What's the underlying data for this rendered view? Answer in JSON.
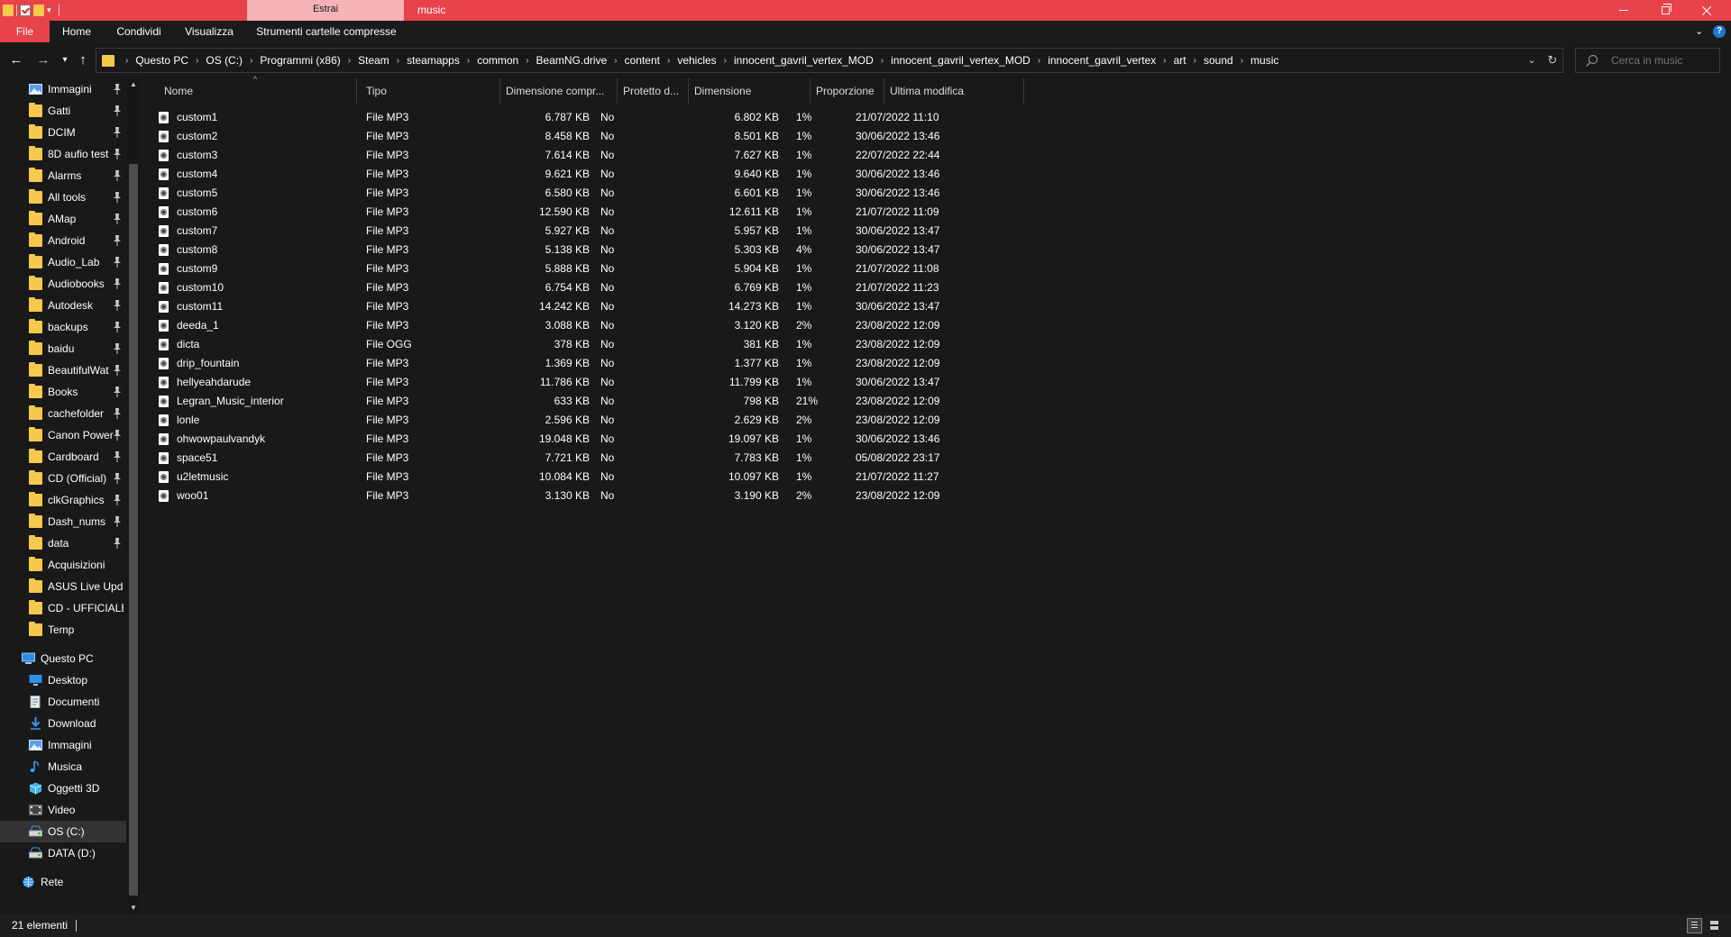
{
  "window": {
    "title": "music",
    "contextual_tab_group": "Estrai",
    "buttons": {
      "minimize": "minimize",
      "maximize": "restore",
      "close": "close"
    }
  },
  "ribbon": {
    "tabs": [
      {
        "label": "File",
        "active": true
      },
      {
        "label": "Home"
      },
      {
        "label": "Condividi"
      },
      {
        "label": "Visualizza"
      },
      {
        "label": "Strumenti cartelle compresse"
      }
    ],
    "help": "?"
  },
  "address": {
    "crumbs": [
      "Questo PC",
      "OS (C:)",
      "Programmi (x86)",
      "Steam",
      "steamapps",
      "common",
      "BeamNG.drive",
      "content",
      "vehicles",
      "innocent_gavril_vertex_MOD",
      "innocent_gavril_vertex_MOD",
      "innocent_gavril_vertex",
      "art",
      "sound",
      "music"
    ]
  },
  "search": {
    "placeholder": "Cerca in music"
  },
  "colors": {
    "accent": "#e8424a",
    "contextual": "#f5b3b7",
    "folder": "#f6c94c",
    "background": "#191919"
  },
  "nav": {
    "quick_access": [
      {
        "label": "Immagini",
        "icon": "pictures-icon",
        "pinned": true
      },
      {
        "label": "Gatti",
        "icon": "folder-icon",
        "pinned": true
      },
      {
        "label": "DCIM",
        "icon": "folder-icon",
        "pinned": true
      },
      {
        "label": "8D aufio test",
        "icon": "folder-icon",
        "pinned": true
      },
      {
        "label": "Alarms",
        "icon": "folder-icon",
        "pinned": true
      },
      {
        "label": "All tools",
        "icon": "folder-icon",
        "pinned": true
      },
      {
        "label": "AMap",
        "icon": "folder-icon",
        "pinned": true
      },
      {
        "label": "Android",
        "icon": "folder-icon",
        "pinned": true
      },
      {
        "label": "Audio_Lab",
        "icon": "folder-icon",
        "pinned": true
      },
      {
        "label": "Audiobooks",
        "icon": "folder-icon",
        "pinned": true
      },
      {
        "label": "Autodesk",
        "icon": "folder-icon",
        "pinned": true
      },
      {
        "label": "backups",
        "icon": "folder-icon",
        "pinned": true
      },
      {
        "label": "baidu",
        "icon": "folder-icon",
        "pinned": true
      },
      {
        "label": "BeautifulWat",
        "icon": "folder-icon",
        "pinned": true
      },
      {
        "label": "Books",
        "icon": "folder-icon",
        "pinned": true
      },
      {
        "label": "cachefolder",
        "icon": "folder-icon",
        "pinned": true
      },
      {
        "label": "Canon Power",
        "icon": "folder-icon",
        "pinned": true
      },
      {
        "label": "Cardboard",
        "icon": "folder-icon",
        "pinned": true
      },
      {
        "label": "CD (Official)",
        "icon": "folder-icon",
        "pinned": true
      },
      {
        "label": "clkGraphics",
        "icon": "folder-icon",
        "pinned": true
      },
      {
        "label": "Dash_nums",
        "icon": "folder-icon",
        "pinned": true
      },
      {
        "label": "data",
        "icon": "folder-icon",
        "pinned": true
      },
      {
        "label": "Acquisizioni",
        "icon": "folder-icon",
        "pinned": false
      },
      {
        "label": "ASUS Live Updat",
        "icon": "folder-icon",
        "pinned": false
      },
      {
        "label": "CD - UFFICIALE",
        "icon": "folder-icon",
        "pinned": false
      },
      {
        "label": "Temp",
        "icon": "folder-icon",
        "pinned": false
      }
    ],
    "this_pc": {
      "label": "Questo PC",
      "children": [
        {
          "label": "Desktop",
          "icon": "desktop-icon"
        },
        {
          "label": "Documenti",
          "icon": "documents-icon"
        },
        {
          "label": "Download",
          "icon": "download-icon"
        },
        {
          "label": "Immagini",
          "icon": "pictures-icon"
        },
        {
          "label": "Musica",
          "icon": "music-icon"
        },
        {
          "label": "Oggetti 3D",
          "icon": "cube-icon"
        },
        {
          "label": "Video",
          "icon": "video-icon"
        },
        {
          "label": "OS (C:)",
          "icon": "drive-icon",
          "selected": true
        },
        {
          "label": "DATA (D:)",
          "icon": "drive-icon"
        }
      ]
    },
    "network": {
      "label": "Rete",
      "icon": "network-icon"
    }
  },
  "columns": [
    "Nome",
    "Tipo",
    "Dimensione compr...",
    "Protetto d...",
    "Dimensione",
    "Proporzione",
    "Ultima modifica"
  ],
  "files": [
    {
      "name": "custom1",
      "type": "File MP3",
      "compressed": "6.787 KB",
      "protected": "No",
      "size": "6.802 KB",
      "ratio": "1%",
      "modified": "21/07/2022 11:10"
    },
    {
      "name": "custom2",
      "type": "File MP3",
      "compressed": "8.458 KB",
      "protected": "No",
      "size": "8.501 KB",
      "ratio": "1%",
      "modified": "30/06/2022 13:46"
    },
    {
      "name": "custom3",
      "type": "File MP3",
      "compressed": "7.614 KB",
      "protected": "No",
      "size": "7.627 KB",
      "ratio": "1%",
      "modified": "22/07/2022 22:44"
    },
    {
      "name": "custom4",
      "type": "File MP3",
      "compressed": "9.621 KB",
      "protected": "No",
      "size": "9.640 KB",
      "ratio": "1%",
      "modified": "30/06/2022 13:46"
    },
    {
      "name": "custom5",
      "type": "File MP3",
      "compressed": "6.580 KB",
      "protected": "No",
      "size": "6.601 KB",
      "ratio": "1%",
      "modified": "30/06/2022 13:46"
    },
    {
      "name": "custom6",
      "type": "File MP3",
      "compressed": "12.590 KB",
      "protected": "No",
      "size": "12.611 KB",
      "ratio": "1%",
      "modified": "21/07/2022 11:09"
    },
    {
      "name": "custom7",
      "type": "File MP3",
      "compressed": "5.927 KB",
      "protected": "No",
      "size": "5.957 KB",
      "ratio": "1%",
      "modified": "30/06/2022 13:47"
    },
    {
      "name": "custom8",
      "type": "File MP3",
      "compressed": "5.138 KB",
      "protected": "No",
      "size": "5.303 KB",
      "ratio": "4%",
      "modified": "30/06/2022 13:47"
    },
    {
      "name": "custom9",
      "type": "File MP3",
      "compressed": "5.888 KB",
      "protected": "No",
      "size": "5.904 KB",
      "ratio": "1%",
      "modified": "21/07/2022 11:08"
    },
    {
      "name": "custom10",
      "type": "File MP3",
      "compressed": "6.754 KB",
      "protected": "No",
      "size": "6.769 KB",
      "ratio": "1%",
      "modified": "21/07/2022 11:23"
    },
    {
      "name": "custom11",
      "type": "File MP3",
      "compressed": "14.242 KB",
      "protected": "No",
      "size": "14.273 KB",
      "ratio": "1%",
      "modified": "30/06/2022 13:47"
    },
    {
      "name": "deeda_1",
      "type": "File MP3",
      "compressed": "3.088 KB",
      "protected": "No",
      "size": "3.120 KB",
      "ratio": "2%",
      "modified": "23/08/2022 12:09"
    },
    {
      "name": "dicta",
      "type": "File OGG",
      "compressed": "378 KB",
      "protected": "No",
      "size": "381 KB",
      "ratio": "1%",
      "modified": "23/08/2022 12:09"
    },
    {
      "name": "drip_fountain",
      "type": "File MP3",
      "compressed": "1.369 KB",
      "protected": "No",
      "size": "1.377 KB",
      "ratio": "1%",
      "modified": "23/08/2022 12:09"
    },
    {
      "name": "hellyeahdarude",
      "type": "File MP3",
      "compressed": "11.786 KB",
      "protected": "No",
      "size": "11.799 KB",
      "ratio": "1%",
      "modified": "30/06/2022 13:47"
    },
    {
      "name": "Legran_Music_interior",
      "type": "File MP3",
      "compressed": "633 KB",
      "protected": "No",
      "size": "798 KB",
      "ratio": "21%",
      "modified": "23/08/2022 12:09"
    },
    {
      "name": "lonle",
      "type": "File MP3",
      "compressed": "2.596 KB",
      "protected": "No",
      "size": "2.629 KB",
      "ratio": "2%",
      "modified": "23/08/2022 12:09"
    },
    {
      "name": "ohwowpaulvandyk",
      "type": "File MP3",
      "compressed": "19.048 KB",
      "protected": "No",
      "size": "19.097 KB",
      "ratio": "1%",
      "modified": "30/06/2022 13:46"
    },
    {
      "name": "space51",
      "type": "File MP3",
      "compressed": "7.721 KB",
      "protected": "No",
      "size": "7.783 KB",
      "ratio": "1%",
      "modified": "05/08/2022 23:17"
    },
    {
      "name": "u2letmusic",
      "type": "File MP3",
      "compressed": "10.084 KB",
      "protected": "No",
      "size": "10.097 KB",
      "ratio": "1%",
      "modified": "21/07/2022 11:27"
    },
    {
      "name": "woo01",
      "type": "File MP3",
      "compressed": "3.130 KB",
      "protected": "No",
      "size": "3.190 KB",
      "ratio": "2%",
      "modified": "23/08/2022 12:09"
    }
  ],
  "status": {
    "count": "21 elementi"
  }
}
